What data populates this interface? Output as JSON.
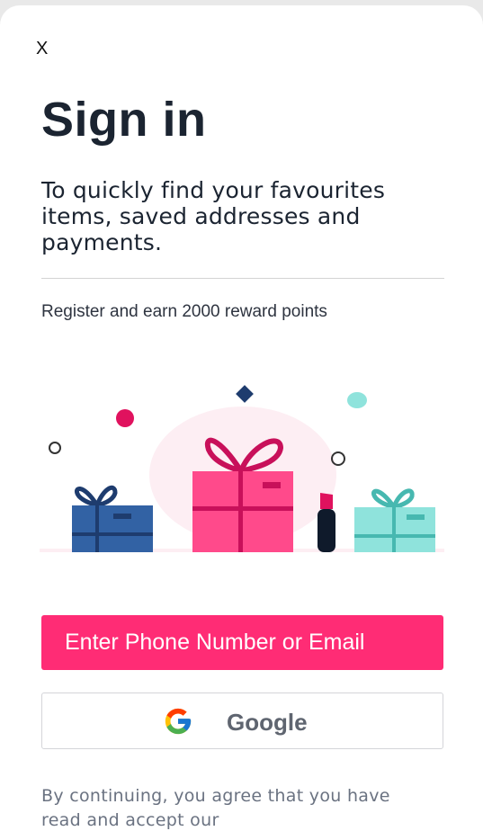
{
  "dialog": {
    "close_label": "X",
    "title": "Sign in",
    "subtitle": "To quickly find your favourites items, saved addresses and payments.",
    "reward_text": "Register and earn 2000 reward points",
    "primary_button_label": "Enter Phone Number or Email",
    "google_button_label": "Google",
    "terms_text": "By continuing, you agree that you have read and accept our"
  },
  "illustration": {
    "icons": [
      "gift-box-icon",
      "lipstick-icon",
      "confetti-icon"
    ]
  },
  "colors": {
    "primary": "#ff2c75",
    "title": "#1b2431",
    "gift_blue": "#3262a4",
    "gift_pink": "#ff4a8b",
    "gift_teal": "#8fe3dc",
    "google_text": "#5f6570"
  }
}
